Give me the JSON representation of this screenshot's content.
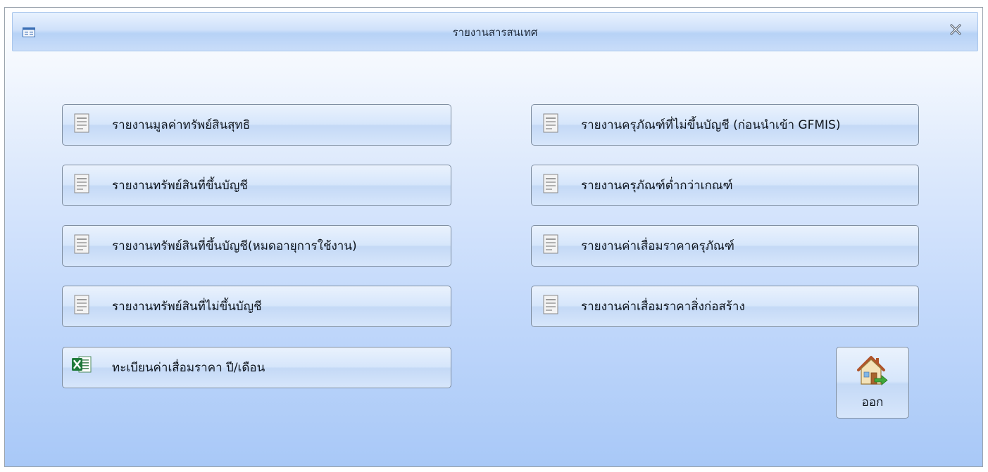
{
  "window": {
    "title": "รายงานสารสนเทศ",
    "icons": {
      "title": "form-window-icon",
      "close": "close-x-icon"
    }
  },
  "reports": {
    "left": [
      {
        "label": "รายงานมูลค่าทรัพย์สินสุทธิ",
        "icon": "report-document-icon"
      },
      {
        "label": "รายงานทรัพย์สินที่ขึ้นบัญชี",
        "icon": "report-document-icon"
      },
      {
        "label": "รายงานทรัพย์สินที่ขึ้นบัญชี(หมดอายุการใช้งาน)",
        "icon": "report-document-icon"
      },
      {
        "label": "รายงานทรัพย์สินที่ไม่ขึ้นบัญชี",
        "icon": "report-document-icon"
      },
      {
        "label": "ทะเบียนค่าเสื่อมราคา ปี/เดือน",
        "icon": "excel-icon"
      }
    ],
    "right": [
      {
        "label": "รายงานครุภัณฑ์ที่ไม่ขึ้นบัญชี (ก่อนนำเข้า GFMIS)",
        "icon": "report-document-icon"
      },
      {
        "label": "รายงานครุภัณฑ์ต่ำกว่าเกณฑ์",
        "icon": "report-document-icon"
      },
      {
        "label": "รายงานค่าเสื่อมราคาครุภัณฑ์",
        "icon": "report-document-icon"
      },
      {
        "label": "รายงานค่าเสื่อมราคาสิ่งก่อสร้าง",
        "icon": "report-document-icon"
      }
    ]
  },
  "exit": {
    "label": "ออก",
    "icon": "home-exit-icon"
  },
  "colors": {
    "button_border": "#7f8ea1",
    "window_gradient_bottom": "#a8c8f7",
    "excel_green": "#1e7a3a"
  }
}
